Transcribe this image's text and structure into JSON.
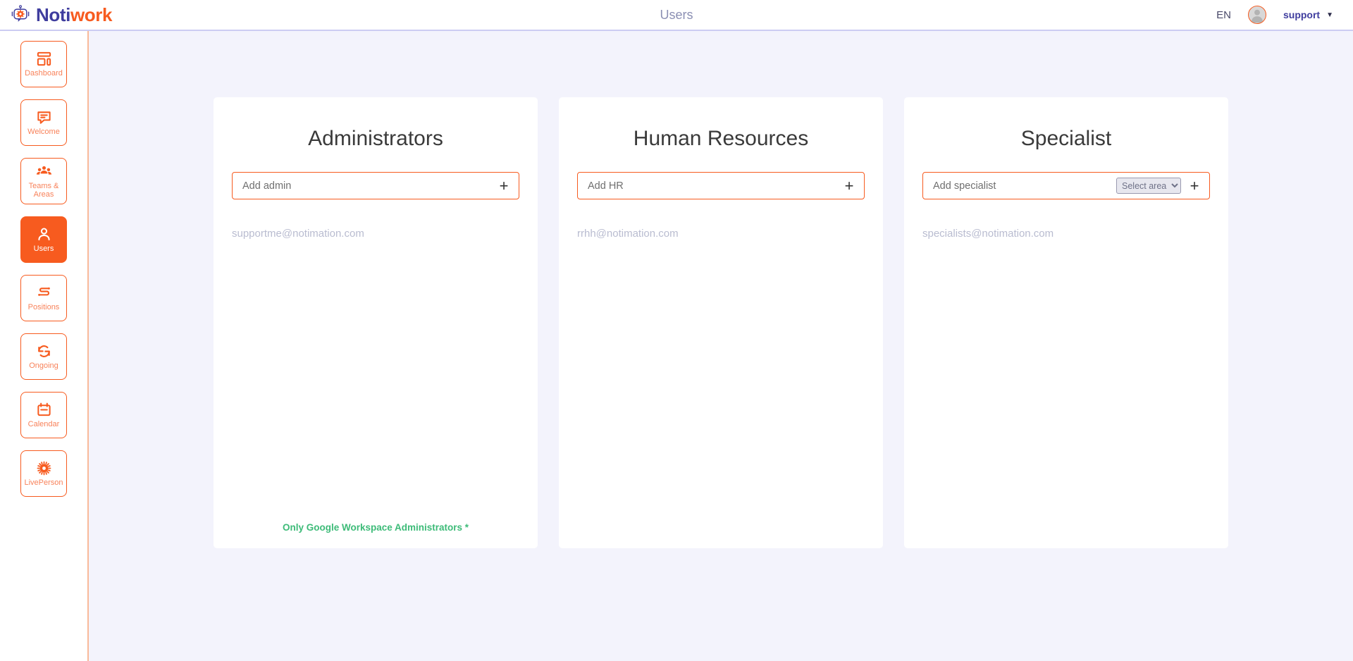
{
  "header": {
    "brand_part1": "Noti",
    "brand_part2": "work",
    "logo_icon": "robot-chat-gear-icon",
    "page_title": "Users",
    "language": "EN",
    "avatar_icon": "user-avatar",
    "user_name": "support",
    "caret_icon": "chevron-down-icon",
    "accent_color": "#f75b1f",
    "brand_color": "#3f3d9e"
  },
  "sidebar": {
    "items": [
      {
        "label": "Dashboard",
        "icon": "dashboard-icon",
        "active": false
      },
      {
        "label": "Welcome",
        "icon": "chat-bubble-icon",
        "active": false
      },
      {
        "label": "Teams & Areas",
        "icon": "people-group-icon",
        "active": false
      },
      {
        "label": "Users",
        "icon": "user-icon",
        "active": true
      },
      {
        "label": "Positions",
        "icon": "path-s-icon",
        "active": false
      },
      {
        "label": "Ongoing",
        "icon": "refresh-cycle-icon",
        "active": false
      },
      {
        "label": "Calendar",
        "icon": "calendar-icon",
        "active": false
      },
      {
        "label": "LivePerson",
        "icon": "gear-sun-icon",
        "active": false
      }
    ]
  },
  "cards": [
    {
      "title": "Administrators",
      "input_placeholder": "Add admin",
      "input_value": "",
      "has_select": false,
      "add_icon": "plus-icon",
      "members": [
        "supportme@notimation.com"
      ],
      "note": "Only Google Workspace Administrators *",
      "note_color": "#3dbb78"
    },
    {
      "title": "Human Resources",
      "input_placeholder": "Add HR",
      "input_value": "",
      "has_select": false,
      "add_icon": "plus-icon",
      "members": [
        "rrhh@notimation.com"
      ],
      "note": "",
      "note_color": "#3dbb78"
    },
    {
      "title": "Specialist",
      "input_placeholder": "Add specialist",
      "input_value": "",
      "has_select": true,
      "select_selected": "Select area",
      "select_options": [
        "Select area"
      ],
      "add_icon": "plus-icon",
      "members": [
        "specialists@notimation.com"
      ],
      "note": "",
      "note_color": "#3dbb78"
    }
  ]
}
